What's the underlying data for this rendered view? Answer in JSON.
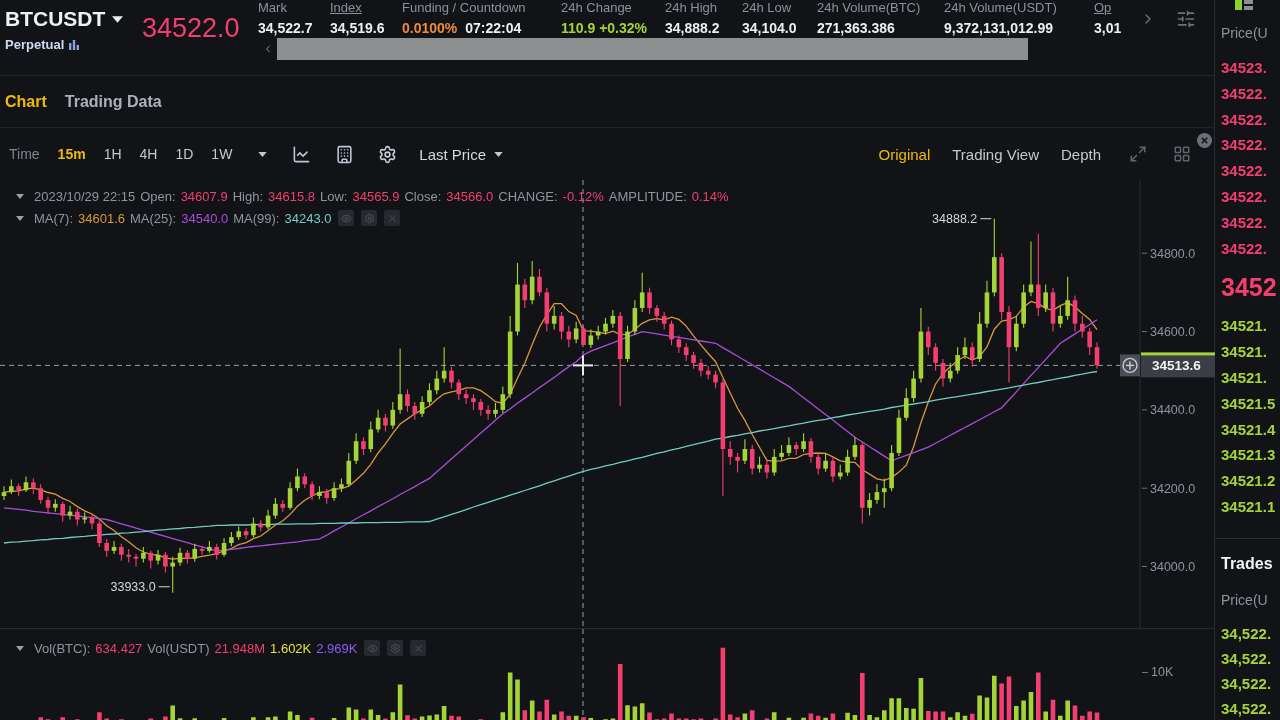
{
  "ticker": {
    "symbol": "BTCUSDT",
    "contract_type": "Perpetual",
    "last_price": "34522.0",
    "rising": false
  },
  "stats": [
    {
      "label": "Mark",
      "underlined": false,
      "values": [
        {
          "text": "34,522.7",
          "color": "#eceff3"
        }
      ]
    },
    {
      "label": "Index",
      "underlined": true,
      "values": [
        {
          "text": "34,519.6",
          "color": "#eceff3"
        }
      ]
    },
    {
      "label": "Funding / Countdown",
      "underlined": false,
      "values": [
        {
          "text": "0.0100%",
          "color": "#ef8b3c"
        },
        {
          "text": "07:22:04",
          "color": "#eceff3"
        }
      ]
    },
    {
      "label": "24h Change",
      "underlined": false,
      "values": [
        {
          "text": "110.9 +0.32%",
          "color": "#a4d437"
        }
      ]
    },
    {
      "label": "24h High",
      "underlined": false,
      "values": [
        {
          "text": "34,888.2",
          "color": "#eceff3"
        }
      ]
    },
    {
      "label": "24h Low",
      "underlined": false,
      "values": [
        {
          "text": "34,104.0",
          "color": "#eceff3"
        }
      ]
    },
    {
      "label": "24h Volume(BTC)",
      "underlined": false,
      "values": [
        {
          "text": "271,363.386",
          "color": "#eceff3"
        }
      ]
    },
    {
      "label": "24h Volume(USDT)",
      "underlined": false,
      "values": [
        {
          "text": "9,372,131,012.99",
          "color": "#eceff3"
        }
      ]
    },
    {
      "label": "Op",
      "underlined": true,
      "values": [
        {
          "text": "3,01",
          "color": "#eceff3"
        }
      ]
    }
  ],
  "view_tabs": [
    {
      "label": "Chart",
      "selected": true
    },
    {
      "label": "Trading Data",
      "selected": false
    }
  ],
  "toolbar": {
    "time_label": "Time",
    "intervals": [
      {
        "label": "15m",
        "selected": true
      },
      {
        "label": "1H",
        "selected": false
      },
      {
        "label": "4H",
        "selected": false
      },
      {
        "label": "1D",
        "selected": false
      },
      {
        "label": "1W",
        "selected": false
      }
    ],
    "price_type": "Last Price",
    "chart_modes": [
      {
        "label": "Original",
        "selected": true
      },
      {
        "label": "Trading View",
        "selected": false
      },
      {
        "label": "Depth",
        "selected": false
      }
    ]
  },
  "ohlc_legend": {
    "timestamp": "2023/10/29 22:15",
    "rising": false,
    "fields": [
      {
        "label": "Open:",
        "value": "34607.9"
      },
      {
        "label": "High:",
        "value": "34615.8"
      },
      {
        "label": "Low:",
        "value": "34565.9"
      },
      {
        "label": "Close:",
        "value": "34566.0"
      },
      {
        "label": "CHANGE:",
        "value": "-0.12%"
      },
      {
        "label": "AMPLITUDE:",
        "value": "0.14%"
      }
    ]
  },
  "ma_legend": [
    {
      "label": "MA(7):",
      "value": "34601.6",
      "color": "#d8973d"
    },
    {
      "label": "MA(25):",
      "value": "34540.0",
      "color": "#a94ddb"
    },
    {
      "label": "MA(99):",
      "value": "34243.0",
      "color": "#74cbc2"
    }
  ],
  "price_chart": {
    "chart_data": {
      "type": "candlestick",
      "categories": [
        null,
        null,
        null,
        null,
        null,
        null,
        null,
        null,
        null,
        null,
        null,
        null,
        null,
        null,
        null,
        null,
        null,
        null,
        null,
        null,
        null,
        null,
        null,
        null,
        null,
        null,
        null,
        null,
        null,
        null,
        null,
        null,
        null,
        null,
        null,
        null,
        null,
        null,
        null,
        null,
        null,
        null,
        null,
        null,
        null,
        null,
        null,
        null,
        null,
        null,
        null,
        null,
        null,
        null,
        null,
        null,
        null,
        null,
        null,
        null,
        null,
        null,
        null,
        null,
        null,
        null,
        null,
        null,
        null,
        null,
        null,
        null,
        null,
        null,
        null,
        null,
        null,
        null,
        null,
        null,
        null,
        null,
        null,
        null,
        null,
        null,
        null,
        null,
        null,
        null,
        null,
        null,
        null,
        null,
        null,
        null,
        null,
        null,
        null,
        null,
        null,
        null,
        null,
        null,
        null,
        null,
        null,
        null,
        null,
        null,
        null,
        null,
        null,
        null,
        null,
        null,
        null,
        null,
        null,
        null,
        null,
        null,
        null,
        null,
        null,
        null,
        null,
        null,
        null,
        null,
        null,
        null,
        null,
        null,
        null,
        null,
        null,
        null,
        null,
        null,
        null,
        null,
        null,
        null,
        null,
        null,
        null,
        null,
        null,
        null
      ],
      "ohlc": [
        [
          34180,
          34205,
          34170,
          34190
        ],
        [
          34190,
          34222,
          34185,
          34205
        ],
        [
          34205,
          34212,
          34180,
          34195
        ],
        [
          34195,
          34230,
          34190,
          34215
        ],
        [
          34215,
          34225,
          34185,
          34200
        ],
        [
          34200,
          34210,
          34160,
          34170
        ],
        [
          34170,
          34178,
          34135,
          34150
        ],
        [
          34150,
          34172,
          34140,
          34160
        ],
        [
          34160,
          34165,
          34115,
          34130
        ],
        [
          34130,
          34155,
          34120,
          34140
        ],
        [
          34140,
          34148,
          34105,
          34120
        ],
        [
          34120,
          34138,
          34110,
          34125
        ],
        [
          34125,
          34135,
          34095,
          34110
        ],
        [
          34110,
          34118,
          34050,
          34060
        ],
        [
          34060,
          34070,
          34025,
          34040
        ],
        [
          34040,
          34065,
          34032,
          34050
        ],
        [
          34050,
          34058,
          34015,
          34030
        ],
        [
          34030,
          34045,
          34010,
          34025
        ],
        [
          34025,
          34032,
          34000,
          34020
        ],
        [
          34020,
          34050,
          34010,
          34035
        ],
        [
          34035,
          34040,
          33995,
          34015
        ],
        [
          34015,
          34042,
          34005,
          34030
        ],
        [
          34030,
          34038,
          33985,
          34000
        ],
        [
          34000,
          34025,
          33933,
          34010
        ],
        [
          34010,
          34048,
          34002,
          34035
        ],
        [
          34035,
          34042,
          34008,
          34020
        ],
        [
          34020,
          34058,
          34012,
          34045
        ],
        [
          34045,
          34052,
          34030,
          34040
        ],
        [
          34040,
          34065,
          34035,
          34050
        ],
        [
          34050,
          34058,
          34018,
          34030
        ],
        [
          34030,
          34072,
          34025,
          34060
        ],
        [
          34060,
          34088,
          34052,
          34075
        ],
        [
          34075,
          34102,
          34068,
          34090
        ],
        [
          34090,
          34098,
          34070,
          34080
        ],
        [
          34080,
          34125,
          34075,
          34110
        ],
        [
          34110,
          34118,
          34090,
          34100
        ],
        [
          34100,
          34145,
          34095,
          34130
        ],
        [
          34130,
          34175,
          34122,
          34160
        ],
        [
          34160,
          34170,
          34140,
          34150
        ],
        [
          34150,
          34215,
          34145,
          34200
        ],
        [
          34200,
          34250,
          34192,
          34230
        ],
        [
          34230,
          34238,
          34200,
          34210
        ],
        [
          34210,
          34218,
          34170,
          34180
        ],
        [
          34180,
          34205,
          34172,
          34190
        ],
        [
          34190,
          34198,
          34160,
          34175
        ],
        [
          34175,
          34215,
          34168,
          34200
        ],
        [
          34200,
          34225,
          34190,
          34210
        ],
        [
          34210,
          34290,
          34205,
          34270
        ],
        [
          34270,
          34340,
          34262,
          34320
        ],
        [
          34320,
          34330,
          34285,
          34300
        ],
        [
          34300,
          34370,
          34292,
          34350
        ],
        [
          34350,
          34400,
          34342,
          34380
        ],
        [
          34380,
          34390,
          34345,
          34360
        ],
        [
          34360,
          34420,
          34352,
          34400
        ],
        [
          34400,
          34557,
          34390,
          34440
        ],
        [
          34440,
          34452,
          34395,
          34410
        ],
        [
          34410,
          34420,
          34375,
          34390
        ],
        [
          34390,
          34435,
          34382,
          34420
        ],
        [
          34420,
          34468,
          34412,
          34450
        ],
        [
          34450,
          34500,
          34440,
          34480
        ],
        [
          34480,
          34560,
          34470,
          34500
        ],
        [
          34500,
          34510,
          34455,
          34470
        ],
        [
          34470,
          34478,
          34425,
          34440
        ],
        [
          34440,
          34452,
          34415,
          34430
        ],
        [
          34430,
          34440,
          34400,
          34420
        ],
        [
          34420,
          34428,
          34385,
          34400
        ],
        [
          34400,
          34412,
          34375,
          34390
        ],
        [
          34390,
          34418,
          34380,
          34400
        ],
        [
          34400,
          34460,
          34392,
          34440
        ],
        [
          34440,
          34640,
          34430,
          34600
        ],
        [
          34600,
          34775,
          34590,
          34720
        ],
        [
          34720,
          34735,
          34660,
          34680
        ],
        [
          34680,
          34780,
          34670,
          34740
        ],
        [
          34740,
          34760,
          34690,
          34700
        ],
        [
          34700,
          34712,
          34600,
          34620
        ],
        [
          34620,
          34665,
          34605,
          34640
        ],
        [
          34640,
          34650,
          34580,
          34600
        ],
        [
          34600,
          34615,
          34560,
          34580
        ],
        [
          34580,
          34625,
          34570,
          34608
        ],
        [
          34607.9,
          34615.8,
          34565.9,
          34566.0
        ],
        [
          34566,
          34605,
          34558,
          34590
        ],
        [
          34590,
          34615,
          34580,
          34600
        ],
        [
          34600,
          34635,
          34592,
          34620
        ],
        [
          34620,
          34655,
          34610,
          34640
        ],
        [
          34640,
          34650,
          34410,
          34530
        ],
        [
          34530,
          34615,
          34522,
          34600
        ],
        [
          34600,
          34680,
          34592,
          34660
        ],
        [
          34660,
          34750,
          34650,
          34700
        ],
        [
          34700,
          34712,
          34645,
          34660
        ],
        [
          34660,
          34668,
          34625,
          34640
        ],
        [
          34640,
          34650,
          34605,
          34620
        ],
        [
          34620,
          34628,
          34565,
          34580
        ],
        [
          34580,
          34590,
          34545,
          34560
        ],
        [
          34560,
          34570,
          34525,
          34540
        ],
        [
          34540,
          34548,
          34505,
          34520
        ],
        [
          34520,
          34530,
          34485,
          34500
        ],
        [
          34500,
          34512,
          34478,
          34490
        ],
        [
          34490,
          34500,
          34455,
          34470
        ],
        [
          34470,
          34478,
          34180,
          34300
        ],
        [
          34300,
          34320,
          34260,
          34280
        ],
        [
          34280,
          34290,
          34240,
          34270
        ],
        [
          34270,
          34325,
          34262,
          34300
        ],
        [
          34300,
          34310,
          34235,
          34250
        ],
        [
          34250,
          34280,
          34240,
          34260
        ],
        [
          34260,
          34270,
          34225,
          34240
        ],
        [
          34240,
          34300,
          34232,
          34280
        ],
        [
          34280,
          34310,
          34272,
          34290
        ],
        [
          34290,
          34330,
          34282,
          34310
        ],
        [
          34310,
          34318,
          34285,
          34300
        ],
        [
          34300,
          34340,
          34292,
          34320
        ],
        [
          34320,
          34328,
          34265,
          34280
        ],
        [
          34280,
          34290,
          34235,
          34250
        ],
        [
          34250,
          34290,
          34242,
          34270
        ],
        [
          34270,
          34278,
          34215,
          34230
        ],
        [
          34230,
          34260,
          34222,
          34240
        ],
        [
          34240,
          34298,
          34232,
          34280
        ],
        [
          34280,
          34330,
          34272,
          34310
        ],
        [
          34310,
          34318,
          34110,
          34150
        ],
        [
          34150,
          34188,
          34130,
          34170
        ],
        [
          34170,
          34210,
          34160,
          34190
        ],
        [
          34190,
          34225,
          34150,
          34200
        ],
        [
          34200,
          34310,
          34192,
          34290
        ],
        [
          34290,
          34400,
          34282,
          34380
        ],
        [
          34380,
          34455,
          34372,
          34430
        ],
        [
          34430,
          34500,
          34420,
          34480
        ],
        [
          34480,
          34660,
          34470,
          34600
        ],
        [
          34600,
          34612,
          34540,
          34560
        ],
        [
          34560,
          34570,
          34500,
          34520
        ],
        [
          34520,
          34530,
          34460,
          34480
        ],
        [
          34480,
          34520,
          34470,
          34500
        ],
        [
          34500,
          34560,
          34492,
          34540
        ],
        [
          34540,
          34585,
          34530,
          34560
        ],
        [
          34560,
          34572,
          34510,
          34530
        ],
        [
          34530,
          34650,
          34522,
          34620
        ],
        [
          34620,
          34730,
          34610,
          34700
        ],
        [
          34700,
          34888.2,
          34690,
          34790
        ],
        [
          34790,
          34800,
          34630,
          34650
        ],
        [
          34650,
          34665,
          34470,
          34560
        ],
        [
          34560,
          34640,
          34550,
          34620
        ],
        [
          34620,
          34720,
          34610,
          34700
        ],
        [
          34700,
          34830,
          34690,
          34720
        ],
        [
          34720,
          34850,
          34640,
          34660
        ],
        [
          34660,
          34720,
          34650,
          34700
        ],
        [
          34700,
          34712,
          34600,
          34620
        ],
        [
          34620,
          34665,
          34610,
          34640
        ],
        [
          34640,
          34740,
          34630,
          34680
        ],
        [
          34680,
          34692,
          34600,
          34620
        ],
        [
          34620,
          34640,
          34585,
          34600
        ],
        [
          34600,
          34610,
          34540,
          34560
        ],
        [
          34560,
          34572,
          34505,
          34513.6
        ]
      ],
      "series": [
        {
          "type": "line",
          "color": "#d8973d",
          "values": [
            34190,
            34192,
            34193,
            34198,
            34200,
            34196,
            34189,
            34185,
            34174,
            34166,
            34153,
            34142,
            34134,
            34121,
            34104,
            34092,
            34076,
            34063,
            34048,
            34037,
            34031,
            34029,
            34022,
            34019,
            34021,
            34021,
            34022,
            34026,
            34029,
            34033,
            34040,
            34046,
            34056,
            34061,
            34071,
            34078,
            34092,
            34106,
            34117,
            34133,
            34154,
            34169,
            34180,
            34189,
            34191,
            34198,
            34199,
            34205,
            34221,
            34238,
            34261,
            34290,
            34313,
            34340,
            34364,
            34377,
            34390,
            34400,
            34410,
            34427,
            34441,
            34446,
            34450,
            34456,
            34456,
            34449,
            34436,
            34421,
            34417,
            34440,
            34481,
            34519,
            34567,
            34611,
            34643,
            34671,
            34671,
            34651,
            34641,
            34602,
            34601,
            34598,
            34595,
            34601,
            34593,
            34592,
            34606,
            34621,
            34630,
            34633,
            34630,
            34637,
            34631,
            34614,
            34589,
            34566,
            34544,
            34523,
            34483,
            34443,
            34404,
            34373,
            34337,
            34304,
            34271,
            34269,
            34270,
            34276,
            34276,
            34286,
            34289,
            34290,
            34289,
            34280,
            34270,
            34267,
            34266,
            34247,
            34236,
            34224,
            34220,
            34227,
            34241,
            34259,
            34306,
            34367,
            34420,
            34466,
            34493,
            34510,
            34526,
            34537,
            34527,
            34536,
            34561,
            34606,
            34627,
            34630,
            34639,
            34663,
            34677,
            34671,
            34659,
            34654,
            34666,
            34674,
            34663,
            34646,
            34631,
            34605
          ]
        },
        {
          "type": "line",
          "color": "#a94ddb",
          "values": [
            34150,
            34148,
            34146,
            34144,
            34141,
            34139,
            34137,
            34135,
            34133,
            34131,
            34129,
            34127,
            34125,
            34122,
            34120,
            34115,
            34109,
            34104,
            34098,
            34093,
            34088,
            34082,
            34077,
            34071,
            34066,
            34061,
            34055,
            34050,
            34045,
            34040,
            34042,
            34044,
            34046,
            34049,
            34051,
            34053,
            34055,
            34057,
            34059,
            34061,
            34063,
            34066,
            34068,
            34070,
            34080,
            34091,
            34101,
            34111,
            34122,
            34132,
            34142,
            34153,
            34163,
            34173,
            34184,
            34194,
            34204,
            34215,
            34225,
            34242,
            34258,
            34275,
            34291,
            34308,
            34324,
            34341,
            34357,
            34374,
            34390,
            34403,
            34417,
            34430,
            34443,
            34457,
            34470,
            34483,
            34497,
            34510,
            34523,
            34540,
            34550,
            34557,
            34564,
            34571,
            34579,
            34586,
            34593,
            34600,
            34597,
            34594,
            34591,
            34588,
            34585,
            34582,
            34579,
            34576,
            34573,
            34570,
            34559,
            34548,
            34537,
            34526,
            34515,
            34504,
            34493,
            34482,
            34471,
            34460,
            34446,
            34431,
            34417,
            34402,
            34388,
            34374,
            34359,
            34345,
            34330,
            34318,
            34306,
            34294,
            34282,
            34270,
            34277,
            34284,
            34291,
            34298,
            34305,
            34315,
            34325,
            34335,
            34345,
            34355,
            34365,
            34375,
            34385,
            34395,
            34405,
            34426,
            34446,
            34467,
            34488,
            34508,
            34529,
            34549,
            34570,
            34582,
            34594,
            34606,
            34618,
            34630
          ]
        },
        {
          "type": "line",
          "color": "#74cbc2",
          "values": [
            34060,
            34062,
            34063,
            34065,
            34066,
            34068,
            34069,
            34071,
            34072,
            34074,
            34076,
            34077,
            34079,
            34080,
            34082,
            34083,
            34085,
            34086,
            34088,
            34089,
            34091,
            34093,
            34094,
            34096,
            34097,
            34099,
            34100,
            34102,
            34103,
            34105,
            34105,
            34106,
            34106,
            34106,
            34107,
            34107,
            34107,
            34108,
            34108,
            34108,
            34109,
            34109,
            34109,
            34110,
            34110,
            34110,
            34111,
            34111,
            34111,
            34112,
            34112,
            34112,
            34113,
            34113,
            34113,
            34114,
            34114,
            34114,
            34115,
            34121,
            34127,
            34133,
            34139,
            34145,
            34152,
            34158,
            34164,
            34170,
            34176,
            34182,
            34188,
            34194,
            34200,
            34206,
            34213,
            34219,
            34225,
            34231,
            34237,
            34243,
            34248,
            34252,
            34257,
            34261,
            34266,
            34270,
            34275,
            34279,
            34284,
            34289,
            34293,
            34298,
            34302,
            34307,
            34311,
            34316,
            34320,
            34325,
            34328,
            34332,
            34335,
            34339,
            34342,
            34346,
            34349,
            34352,
            34356,
            34359,
            34363,
            34366,
            34370,
            34373,
            34376,
            34380,
            34383,
            34387,
            34390,
            34393,
            34396,
            34399,
            34402,
            34406,
            34409,
            34412,
            34415,
            34418,
            34421,
            34425,
            34428,
            34431,
            34434,
            34437,
            34440,
            34443,
            34447,
            34450,
            34453,
            34456,
            34460,
            34463,
            34467,
            34470,
            34474,
            34477,
            34481,
            34484,
            34488,
            34491,
            34495,
            34498
          ]
        }
      ],
      "ylim": [
        33843,
        34987
      ],
      "yticks": [
        {
          "value": 34000,
          "label": "34000.0"
        },
        {
          "value": 34200,
          "label": "34200.0"
        },
        {
          "value": 34400,
          "label": "34400.0"
        },
        {
          "value": 34600,
          "label": "34600.0"
        },
        {
          "value": 34800,
          "label": "34800.0"
        }
      ],
      "tick_labels": "y",
      "ref_lines": [
        {
          "axis": "y",
          "value": 34513.6,
          "label": "34513.6",
          "line_style": "dashed"
        }
      ],
      "annotations": [
        "34888.2",
        "33933.0"
      ]
    }
  },
  "volume_pane": {
    "legend": [
      {
        "label": "Vol(BTC):",
        "value": "634.427",
        "color": "#f23f6f"
      },
      {
        "label": "Vol(USDT)",
        "value": "21.948M",
        "color": "#f23f6f"
      },
      {
        "value": "1.602K",
        "color": "#e4e23c"
      },
      {
        "value": "2.969K",
        "color": "#8a5cf6"
      }
    ],
    "axis_label": "10K"
  },
  "order_book": {
    "header": "Price(U",
    "asks": [
      "34523.",
      "34522.",
      "34522.",
      "34522.",
      "34522.",
      "34522.",
      "34522.",
      "34522."
    ],
    "mid_price": "3452",
    "mid_rising": false,
    "bids": [
      "34521.",
      "34521.",
      "34521.",
      "34521.5",
      "34521.4",
      "34521.3",
      "34521.2",
      "34521.1"
    ]
  },
  "trades": {
    "title": "Trades",
    "header": "Price(U",
    "rows": [
      {
        "price": "34,522.",
        "buy": true
      },
      {
        "price": "34,522.",
        "buy": true
      },
      {
        "price": "34,522.",
        "buy": true
      },
      {
        "price": "34,522.",
        "buy": true
      }
    ]
  }
}
